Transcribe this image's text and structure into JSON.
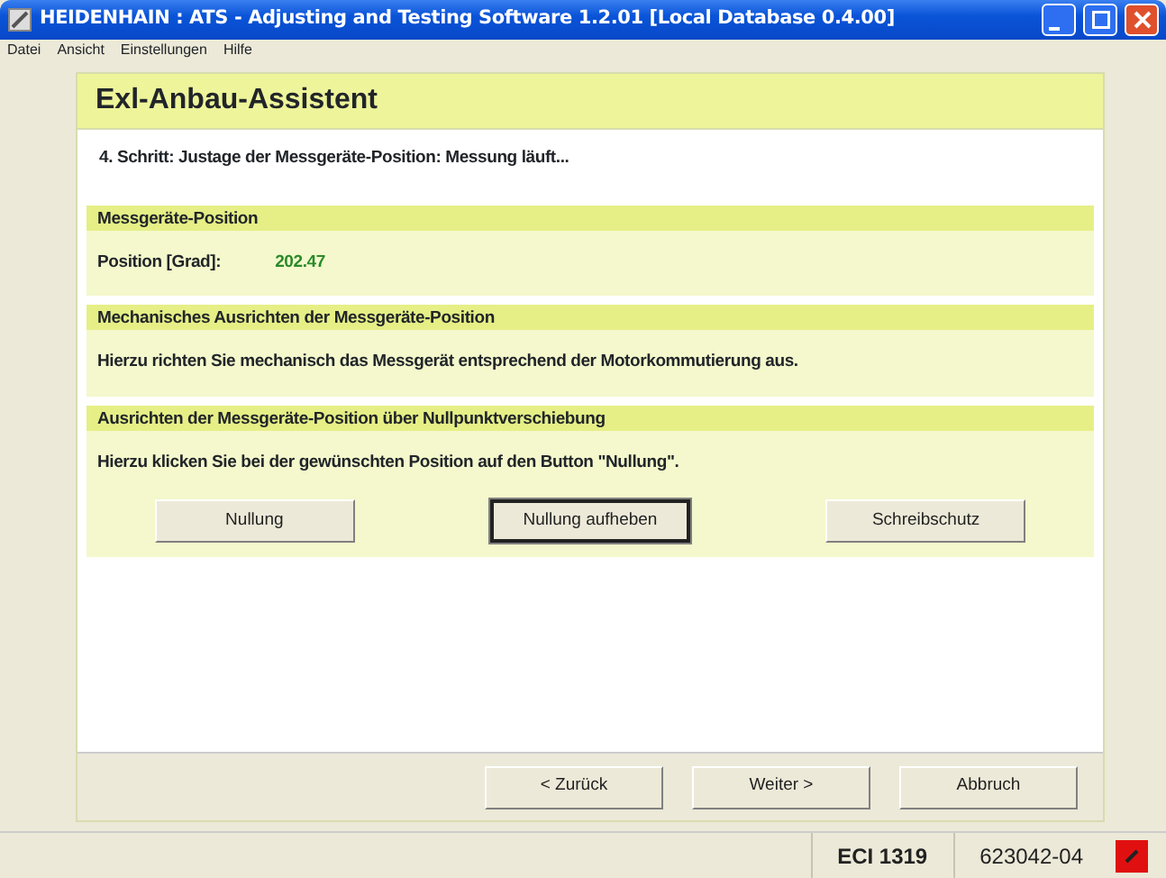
{
  "window": {
    "title": "HEIDENHAIN : ATS - Adjusting and Testing Software 1.2.01 [Local Database 0.4.00]"
  },
  "menu": [
    "Datei",
    "Ansicht",
    "Einstellungen",
    "Hilfe"
  ],
  "wizard": {
    "title": "Exl-Anbau-Assistent",
    "step": "4. Schritt: Justage der Messgeräte-Position: Messung läuft...",
    "sections": [
      {
        "heading": "Messgeräte-Position",
        "kind": "reading",
        "label": "Position [Grad]:",
        "value": "202.47"
      },
      {
        "heading": "Mechanisches Ausrichten der Messgeräte-Position",
        "kind": "text",
        "text": "Hierzu richten Sie mechanisch das Messgerät entsprechend der Motorkommutierung aus."
      },
      {
        "heading": "Ausrichten der Messgeräte-Position über Nullpunktverschiebung",
        "kind": "buttons",
        "text": "Hierzu klicken Sie bei der gewünschten Position auf den Button \"Nullung\".",
        "buttons": [
          {
            "label": "Nullung",
            "default": false
          },
          {
            "label": "Nullung aufheben",
            "default": true
          },
          {
            "label": "Schreibschutz",
            "default": false
          }
        ]
      }
    ]
  },
  "nav_buttons": [
    "< Zurück",
    "Weiter >",
    "Abbruch"
  ],
  "status_bar": [
    "ECI 1319",
    "623042-04"
  ]
}
